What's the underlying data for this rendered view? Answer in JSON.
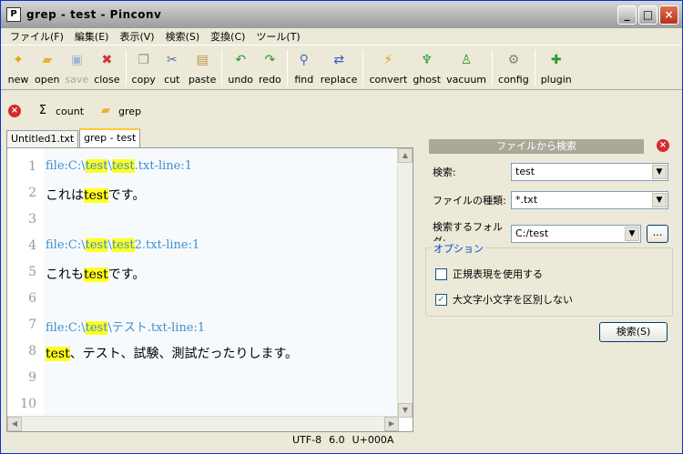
{
  "window": {
    "title": "grep - test - Pinconv",
    "min": "_",
    "max": "□",
    "close": "×"
  },
  "menu": [
    "ファイル(F)",
    "編集(E)",
    "表示(V)",
    "検索(S)",
    "変換(C)",
    "ツール(T)"
  ],
  "toolbar": [
    {
      "label": "new",
      "icon": "new-file-icon",
      "glyph": "✦",
      "color": "#e0a020"
    },
    {
      "label": "open",
      "icon": "open-folder-icon",
      "glyph": "▰",
      "color": "#e8b030"
    },
    {
      "label": "save",
      "icon": "save-icon",
      "glyph": "▣",
      "color": "#9cb8d8",
      "disabled": true
    },
    {
      "label": "close",
      "icon": "close-file-icon",
      "glyph": "✖",
      "color": "#d83030"
    },
    {
      "sep": true
    },
    {
      "label": "copy",
      "icon": "copy-icon",
      "glyph": "❐",
      "color": "#909090"
    },
    {
      "label": "cut",
      "icon": "cut-icon",
      "glyph": "✂",
      "color": "#5070b0"
    },
    {
      "label": "paste",
      "icon": "paste-icon",
      "glyph": "▤",
      "color": "#c09040"
    },
    {
      "sep": true
    },
    {
      "label": "undo",
      "icon": "undo-icon",
      "glyph": "↶",
      "color": "#2a9a2a"
    },
    {
      "label": "redo",
      "icon": "redo-icon",
      "glyph": "↷",
      "color": "#2a9a2a"
    },
    {
      "sep": true
    },
    {
      "label": "find",
      "icon": "find-icon",
      "glyph": "⚲",
      "color": "#4070c0"
    },
    {
      "label": "replace",
      "icon": "replace-icon",
      "glyph": "⇄",
      "color": "#3060c0"
    },
    {
      "sep": true
    },
    {
      "label": "convert",
      "icon": "convert-icon",
      "glyph": "⚡",
      "color": "#e0a000"
    },
    {
      "label": "ghost",
      "icon": "ghost-icon",
      "glyph": "♆",
      "color": "#2a9a2a"
    },
    {
      "label": "vacuum",
      "icon": "vacuum-icon",
      "glyph": "♙",
      "color": "#2a9a2a"
    },
    {
      "sep": true
    },
    {
      "label": "config",
      "icon": "config-gear-icon",
      "glyph": "⚙",
      "color": "#808080"
    },
    {
      "sep": true
    },
    {
      "label": "plugin",
      "icon": "plugin-icon",
      "glyph": "✚",
      "color": "#2a9a2a"
    }
  ],
  "subbar": {
    "count_label": "count",
    "count_glyph": "Σ",
    "grep_label": "grep",
    "grep_glyph": "▰",
    "close_glyph": "×"
  },
  "tabs": [
    {
      "label": "Untitled1.txt",
      "active": false
    },
    {
      "label": "grep - test",
      "active": true
    }
  ],
  "editor": {
    "lines": [
      {
        "num": "1",
        "kind": "file",
        "parts": [
          {
            "t": "file:C:\\"
          },
          {
            "t": "test",
            "h": true
          },
          {
            "t": "\\"
          },
          {
            "t": "test",
            "h": true
          },
          {
            "t": ".txt-line:1"
          }
        ]
      },
      {
        "num": "2",
        "kind": "text",
        "parts": [
          {
            "t": "これは"
          },
          {
            "t": "test",
            "h": true
          },
          {
            "t": "です。"
          }
        ]
      },
      {
        "num": "3",
        "kind": "text",
        "parts": []
      },
      {
        "num": "4",
        "kind": "file",
        "parts": [
          {
            "t": "file:C:\\"
          },
          {
            "t": "test",
            "h": true
          },
          {
            "t": "\\"
          },
          {
            "t": "test",
            "h": true
          },
          {
            "t": "2.txt-line:1"
          }
        ]
      },
      {
        "num": "5",
        "kind": "text",
        "parts": [
          {
            "t": "これも"
          },
          {
            "t": "test",
            "h": true
          },
          {
            "t": "です。"
          }
        ]
      },
      {
        "num": "6",
        "kind": "text",
        "parts": []
      },
      {
        "num": "7",
        "kind": "file",
        "parts": [
          {
            "t": "file:C:\\"
          },
          {
            "t": "test",
            "h": true
          },
          {
            "t": "\\テスト.txt-line:1"
          }
        ]
      },
      {
        "num": "8",
        "kind": "text",
        "parts": [
          {
            "t": "test",
            "h": true
          },
          {
            "t": "、テスト、試験、測試だったりします。"
          }
        ]
      },
      {
        "num": "9",
        "kind": "text",
        "parts": []
      },
      {
        "num": "10",
        "kind": "text",
        "parts": []
      }
    ]
  },
  "status": {
    "encoding": "UTF-8",
    "position": "6.0",
    "char": "U+000A"
  },
  "panel": {
    "title": "ファイルから検索",
    "search_label": "検索:",
    "search_value": "test",
    "type_label": "ファイルの種類:",
    "type_value": "*.txt",
    "folder_label": "検索するフォルダ:",
    "folder_value": "C:/test",
    "browse_label": "...",
    "options_legend": "オプション",
    "regex_label": "正規表現を使用する",
    "regex_checked": false,
    "ignorecase_label": "大文字小文字を区別しない",
    "ignorecase_checked": true,
    "search_button": "検索(S)"
  }
}
